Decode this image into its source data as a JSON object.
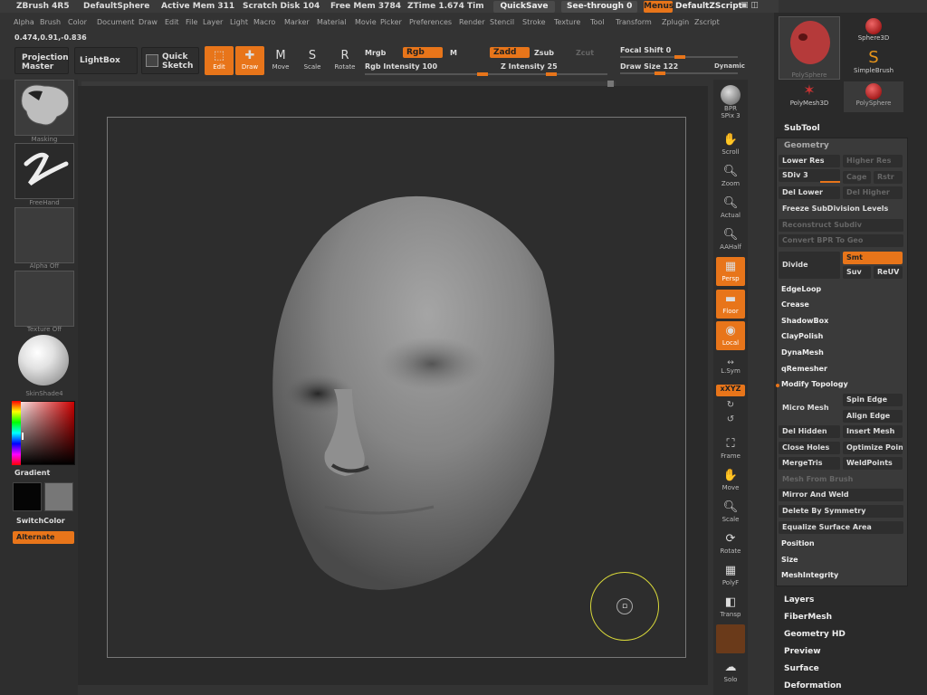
{
  "titlebar": {
    "app": "ZBrush 4R5",
    "doc": "DefaultSphere",
    "active_mem": "Active Mem 311",
    "scratch": "Scratch Disk 104",
    "free_mem": "Free Mem 3784",
    "ztime": "ZTime 1.674 Tim",
    "quicksave": "QuickSave",
    "seethrough": "See-through 0",
    "menus": "Menus",
    "script": "DefaultZScript"
  },
  "menus": [
    "Alpha",
    "Brush",
    "Color",
    "Document",
    "Draw",
    "Edit",
    "File",
    "Layer",
    "Light",
    "Macro",
    "Marker",
    "Material",
    "Movie",
    "Picker",
    "Preferences",
    "Render",
    "Stencil",
    "Stroke",
    "Texture",
    "Tool",
    "Transform",
    "Zplugin",
    "Zscript"
  ],
  "coord": "0.474,0.91,-0.836",
  "topbar": {
    "projection_master": "Projection Master",
    "lightbox": "LightBox",
    "quick_sketch": "Quick Sketch",
    "edit": "Edit",
    "draw": "Draw",
    "move": "Move",
    "scale": "Scale",
    "rotate": "Rotate",
    "mrgb": "Mrgb",
    "rgb": "Rgb",
    "m": "M",
    "rgb_intensity": "Rgb Intensity 100",
    "zadd": "Zadd",
    "zsub": "Zsub",
    "zcut": "Zcut",
    "z_intensity": "Z Intensity 25",
    "focal_shift": "Focal Shift 0",
    "draw_size": "Draw Size 122",
    "dynamic": "Dynamic"
  },
  "leftpanel": {
    "brush_label": "Masking",
    "stroke_label": "FreeHand",
    "alpha_label": "Alpha Off",
    "texture_label": "Texture Off",
    "material_label": "SkinShade4",
    "gradient": "Gradient",
    "switchcolor": "SwitchColor",
    "alternate": "Alternate"
  },
  "rightshelf": [
    "BPR",
    "SPix 3",
    "Scroll",
    "Zoom",
    "Actual",
    "AAHalf",
    "Persp",
    "Floor",
    "Local",
    "L.Sym",
    "xXYZ",
    "",
    "",
    "Frame",
    "Move",
    "Scale",
    "Rotate",
    "PolyF",
    "Transp",
    "",
    "Solo"
  ],
  "tools": {
    "t1": "PolySphere",
    "t2": "Sphere3D",
    "t3": "SimpleBrush",
    "t4": "PolyMesh3D",
    "t5": "PolySphere"
  },
  "subtool": "SubTool",
  "geometry": {
    "title": "Geometry",
    "lower_res": "Lower Res",
    "higher_res": "Higher Res",
    "sdiv": "SDiv 3",
    "cage": "Cage",
    "rstr": "Rstr",
    "del_lower": "Del Lower",
    "del_higher": "Del Higher",
    "freeze": "Freeze SubDivision Levels",
    "reconstruct": "Reconstruct Subdiv",
    "convert_bpr": "Convert BPR To Geo",
    "divide": "Divide",
    "smt": "Smt",
    "suv": "Suv",
    "reuv": "ReUV",
    "edgeloop": "EdgeLoop",
    "crease": "Crease",
    "shadowbox": "ShadowBox",
    "claypolish": "ClayPolish",
    "dynamesh": "DynaMesh",
    "qremesher": "qRemesher",
    "modify_topology": "Modify Topology",
    "spin_edge": "Spin Edge",
    "micro_mesh": "Micro Mesh",
    "align_edge": "Align Edge",
    "del_hidden": "Del Hidden",
    "insert_mesh": "Insert Mesh",
    "close_holes": "Close Holes",
    "optimize_point": "Optimize Poin",
    "mergetris": "MergeTris",
    "weldpoints": "WeldPoints",
    "mesh_from_brush": "Mesh From Brush",
    "mirror_weld": "Mirror And Weld",
    "delete_symmetry": "Delete By Symmetry",
    "equalize": "Equalize Surface Area",
    "position": "Position",
    "size": "Size",
    "meshintegrity": "MeshIntegrity"
  },
  "sections": [
    "Layers",
    "FiberMesh",
    "Geometry HD",
    "Preview",
    "Surface",
    "Deformation"
  ],
  "colors": {
    "accent": "#e8751a",
    "panel": "#3a3a3a"
  }
}
